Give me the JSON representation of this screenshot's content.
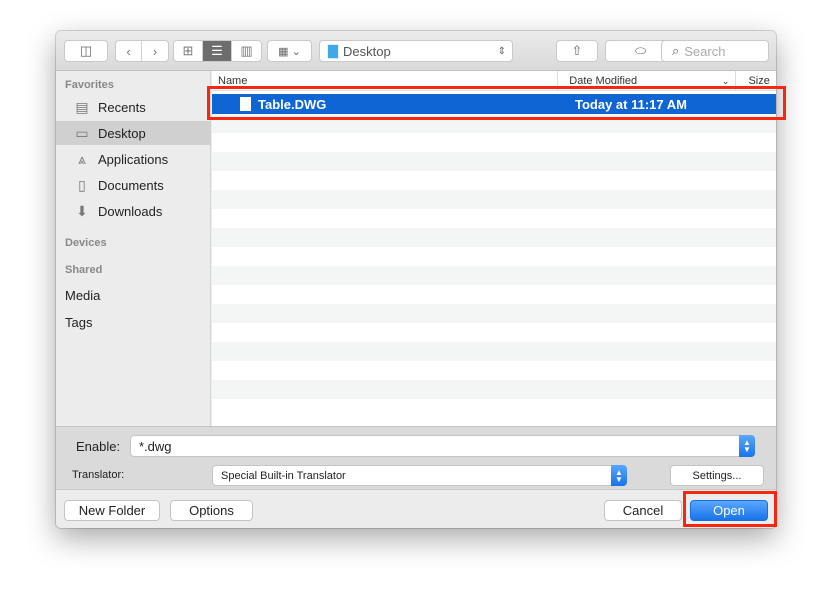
{
  "toolbar": {
    "location": "Desktop",
    "search_placeholder": "Search"
  },
  "sidebar": {
    "favorites_label": "Favorites",
    "items": [
      {
        "label": "Recents",
        "icon": "recents-icon"
      },
      {
        "label": "Desktop",
        "icon": "desktop-icon",
        "selected": true
      },
      {
        "label": "Applications",
        "icon": "applications-icon"
      },
      {
        "label": "Documents",
        "icon": "documents-icon"
      },
      {
        "label": "Downloads",
        "icon": "downloads-icon"
      }
    ],
    "devices_label": "Devices",
    "shared_label": "Shared",
    "media_label": "Media",
    "tags_label": "Tags"
  },
  "list": {
    "columns": [
      "Name",
      "Date Modified",
      "Size"
    ],
    "files": [
      {
        "name": "Table.DWG",
        "modified": "Today at 11:17 AM",
        "selected": true
      }
    ]
  },
  "accessory": {
    "enable_label": "Enable:",
    "enable_value": "*.dwg",
    "translator_label": "Translator:",
    "translator_value": "Special Built-in Translator",
    "settings_label": "Settings..."
  },
  "buttons": {
    "new_folder": "New Folder",
    "options": "Options",
    "cancel": "Cancel",
    "open": "Open"
  },
  "colors": {
    "selection": "#0f65d4",
    "highlight": "#f5270e",
    "accent": "#1874ea"
  }
}
